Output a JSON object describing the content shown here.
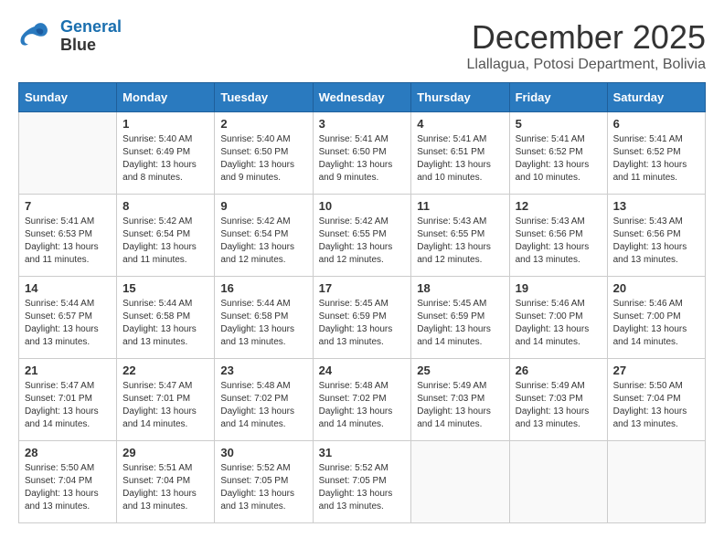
{
  "logo": {
    "line1": "General",
    "line2": "Blue"
  },
  "title": "December 2025",
  "location": "Llallagua, Potosi Department, Bolivia",
  "days_header": [
    "Sunday",
    "Monday",
    "Tuesday",
    "Wednesday",
    "Thursday",
    "Friday",
    "Saturday"
  ],
  "weeks": [
    [
      {
        "day": "",
        "info": ""
      },
      {
        "day": "1",
        "info": "Sunrise: 5:40 AM\nSunset: 6:49 PM\nDaylight: 13 hours\nand 8 minutes."
      },
      {
        "day": "2",
        "info": "Sunrise: 5:40 AM\nSunset: 6:50 PM\nDaylight: 13 hours\nand 9 minutes."
      },
      {
        "day": "3",
        "info": "Sunrise: 5:41 AM\nSunset: 6:50 PM\nDaylight: 13 hours\nand 9 minutes."
      },
      {
        "day": "4",
        "info": "Sunrise: 5:41 AM\nSunset: 6:51 PM\nDaylight: 13 hours\nand 10 minutes."
      },
      {
        "day": "5",
        "info": "Sunrise: 5:41 AM\nSunset: 6:52 PM\nDaylight: 13 hours\nand 10 minutes."
      },
      {
        "day": "6",
        "info": "Sunrise: 5:41 AM\nSunset: 6:52 PM\nDaylight: 13 hours\nand 11 minutes."
      }
    ],
    [
      {
        "day": "7",
        "info": "Sunrise: 5:41 AM\nSunset: 6:53 PM\nDaylight: 13 hours\nand 11 minutes."
      },
      {
        "day": "8",
        "info": "Sunrise: 5:42 AM\nSunset: 6:54 PM\nDaylight: 13 hours\nand 11 minutes."
      },
      {
        "day": "9",
        "info": "Sunrise: 5:42 AM\nSunset: 6:54 PM\nDaylight: 13 hours\nand 12 minutes."
      },
      {
        "day": "10",
        "info": "Sunrise: 5:42 AM\nSunset: 6:55 PM\nDaylight: 13 hours\nand 12 minutes."
      },
      {
        "day": "11",
        "info": "Sunrise: 5:43 AM\nSunset: 6:55 PM\nDaylight: 13 hours\nand 12 minutes."
      },
      {
        "day": "12",
        "info": "Sunrise: 5:43 AM\nSunset: 6:56 PM\nDaylight: 13 hours\nand 13 minutes."
      },
      {
        "day": "13",
        "info": "Sunrise: 5:43 AM\nSunset: 6:56 PM\nDaylight: 13 hours\nand 13 minutes."
      }
    ],
    [
      {
        "day": "14",
        "info": "Sunrise: 5:44 AM\nSunset: 6:57 PM\nDaylight: 13 hours\nand 13 minutes."
      },
      {
        "day": "15",
        "info": "Sunrise: 5:44 AM\nSunset: 6:58 PM\nDaylight: 13 hours\nand 13 minutes."
      },
      {
        "day": "16",
        "info": "Sunrise: 5:44 AM\nSunset: 6:58 PM\nDaylight: 13 hours\nand 13 minutes."
      },
      {
        "day": "17",
        "info": "Sunrise: 5:45 AM\nSunset: 6:59 PM\nDaylight: 13 hours\nand 13 minutes."
      },
      {
        "day": "18",
        "info": "Sunrise: 5:45 AM\nSunset: 6:59 PM\nDaylight: 13 hours\nand 14 minutes."
      },
      {
        "day": "19",
        "info": "Sunrise: 5:46 AM\nSunset: 7:00 PM\nDaylight: 13 hours\nand 14 minutes."
      },
      {
        "day": "20",
        "info": "Sunrise: 5:46 AM\nSunset: 7:00 PM\nDaylight: 13 hours\nand 14 minutes."
      }
    ],
    [
      {
        "day": "21",
        "info": "Sunrise: 5:47 AM\nSunset: 7:01 PM\nDaylight: 13 hours\nand 14 minutes."
      },
      {
        "day": "22",
        "info": "Sunrise: 5:47 AM\nSunset: 7:01 PM\nDaylight: 13 hours\nand 14 minutes."
      },
      {
        "day": "23",
        "info": "Sunrise: 5:48 AM\nSunset: 7:02 PM\nDaylight: 13 hours\nand 14 minutes."
      },
      {
        "day": "24",
        "info": "Sunrise: 5:48 AM\nSunset: 7:02 PM\nDaylight: 13 hours\nand 14 minutes."
      },
      {
        "day": "25",
        "info": "Sunrise: 5:49 AM\nSunset: 7:03 PM\nDaylight: 13 hours\nand 14 minutes."
      },
      {
        "day": "26",
        "info": "Sunrise: 5:49 AM\nSunset: 7:03 PM\nDaylight: 13 hours\nand 13 minutes."
      },
      {
        "day": "27",
        "info": "Sunrise: 5:50 AM\nSunset: 7:04 PM\nDaylight: 13 hours\nand 13 minutes."
      }
    ],
    [
      {
        "day": "28",
        "info": "Sunrise: 5:50 AM\nSunset: 7:04 PM\nDaylight: 13 hours\nand 13 minutes."
      },
      {
        "day": "29",
        "info": "Sunrise: 5:51 AM\nSunset: 7:04 PM\nDaylight: 13 hours\nand 13 minutes."
      },
      {
        "day": "30",
        "info": "Sunrise: 5:52 AM\nSunset: 7:05 PM\nDaylight: 13 hours\nand 13 minutes."
      },
      {
        "day": "31",
        "info": "Sunrise: 5:52 AM\nSunset: 7:05 PM\nDaylight: 13 hours\nand 13 minutes."
      },
      {
        "day": "",
        "info": ""
      },
      {
        "day": "",
        "info": ""
      },
      {
        "day": "",
        "info": ""
      }
    ]
  ]
}
